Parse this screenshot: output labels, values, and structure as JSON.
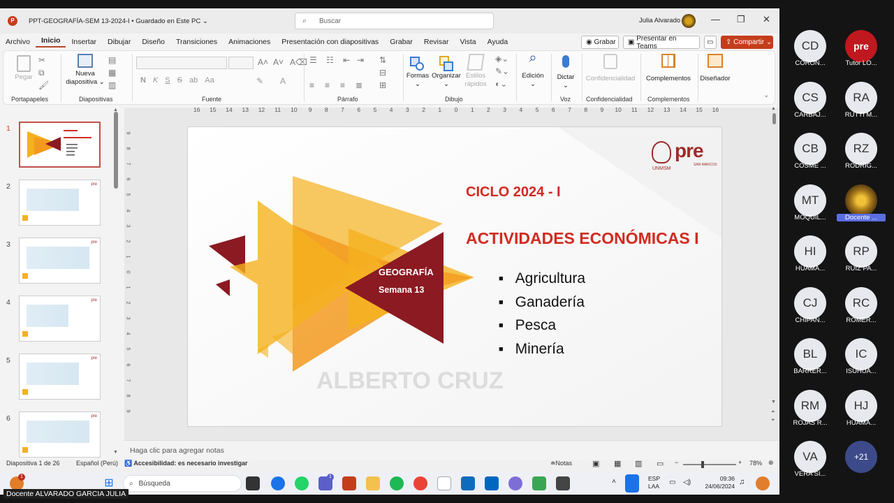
{
  "titlebar": {
    "app_icon": "P",
    "document_title": "PPT-GEOGRAFÍA-SEM 13-2024-I",
    "save_status": "Guardado en Este PC",
    "search_icon": "search-icon",
    "search_placeholder": "Buscar",
    "user_name": "Julia Alvarado",
    "minimize": "—",
    "restore": "❐",
    "close": "✕"
  },
  "menu": {
    "tabs": [
      "Archivo",
      "Inicio",
      "Insertar",
      "Dibujar",
      "Diseño",
      "Transiciones",
      "Animaciones",
      "Presentación con diapositivas",
      "Grabar",
      "Revisar",
      "Vista",
      "Ayuda"
    ],
    "active": "Inicio",
    "record_btn": "Grabar",
    "present_teams_btn": "Presentar en Teams",
    "share_btn": "Compartir"
  },
  "ribbon": {
    "groups": [
      "Portapapeles",
      "Diapositivas",
      "Fuente",
      "Párrafo",
      "Dibujo",
      "Voz",
      "Confidencialidad",
      "Complementos"
    ],
    "paste": "Pegar",
    "new_slide_line1": "Nueva",
    "new_slide_line2": "diapositiva",
    "shapes": "Formas",
    "arrange": "Organizar",
    "quick_styles_line1": "Estilos",
    "quick_styles_line2": "rápidos",
    "find": "Edición",
    "dictate": "Dictar",
    "sensitivity": "Confidencialidad",
    "addins": "Complementos",
    "designer": "Diseñador",
    "font_buttons": [
      "N",
      "K",
      "S",
      "S",
      "ab",
      "Aa"
    ]
  },
  "ruler": {
    "h_ticks": [
      "16",
      "15",
      "14",
      "13",
      "12",
      "11",
      "10",
      "9",
      "8",
      "7",
      "6",
      "5",
      "4",
      "3",
      "2",
      "1",
      "0",
      "1",
      "2",
      "3",
      "4",
      "5",
      "6",
      "7",
      "8",
      "9",
      "10",
      "11",
      "12",
      "13",
      "14",
      "15",
      "16"
    ],
    "v_ticks": [
      "9",
      "8",
      "7",
      "6",
      "5",
      "4",
      "3",
      "2",
      "1",
      "0",
      "1",
      "2",
      "3",
      "4",
      "5",
      "6",
      "7",
      "8",
      "9"
    ]
  },
  "thumbnails": [
    {
      "num": "1",
      "selected": true
    },
    {
      "num": "2"
    },
    {
      "num": "3"
    },
    {
      "num": "4"
    },
    {
      "num": "5"
    },
    {
      "num": "6"
    }
  ],
  "slide": {
    "cycle": "CICLO 2024 - I",
    "title": "ACTIVIDADES ECONÓMICAS I",
    "subject": "GEOGRAFÍA",
    "week": "Semana 13",
    "bullets": [
      "Agricultura",
      "Ganadería",
      "Pesca",
      "Minería"
    ],
    "watermark": "ALBERTO CRUZ",
    "logo_text": "pre",
    "logo_sub": "SAN MARCOS",
    "logo_unmsm": "UNMSM",
    "colors": {
      "red": "#d12a1f",
      "dark_red": "#8b1a22",
      "yellow": "#f5b11e",
      "orange": "#f39a1e"
    }
  },
  "notes_placeholder": "Haga clic para agregar notas",
  "status": {
    "slide_counter": "Diapositiva 1 de 26",
    "language": "Español (Perú)",
    "accessibility": "Accesibilidad: es necesario investigar",
    "notes_btn": "Notas",
    "zoom": "78%"
  },
  "taskbar": {
    "search_placeholder": "Búsqueda",
    "lang_line1": "ESP",
    "lang_line2": "LAA",
    "time": "09:36",
    "date": "24/06/2024",
    "notification_badge": "1",
    "teams_badge": "1"
  },
  "presenter_tag": "Docente ALVARADO GARCIA JULIA",
  "participants": [
    {
      "initials": "CD",
      "name": "CORON..."
    },
    {
      "initials": "pre",
      "name": "Tutor LO...",
      "logo": true
    },
    {
      "initials": "CS",
      "name": "CARBAJ..."
    },
    {
      "initials": "RA",
      "name": "RUTTI M..."
    },
    {
      "initials": "CB",
      "name": "COSME ..."
    },
    {
      "initials": "RZ",
      "name": "RODRIG..."
    },
    {
      "initials": "MT",
      "name": "MOQUIL..."
    },
    {
      "initials": "",
      "name": "Docente ...",
      "photo": true
    },
    {
      "initials": "HI",
      "name": "HUAMA..."
    },
    {
      "initials": "RP",
      "name": "RUIZ PA..."
    },
    {
      "initials": "CJ",
      "name": "CHIPAN..."
    },
    {
      "initials": "RC",
      "name": "ROMER..."
    },
    {
      "initials": "BL",
      "name": "BARRER..."
    },
    {
      "initials": "IC",
      "name": "ISUHUA..."
    },
    {
      "initials": "RM",
      "name": "ROJAS R..."
    },
    {
      "initials": "HJ",
      "name": "HUAMA..."
    },
    {
      "initials": "VA",
      "name": "VERA SI..."
    },
    {
      "initials": "+21",
      "name": "",
      "more": true
    }
  ]
}
